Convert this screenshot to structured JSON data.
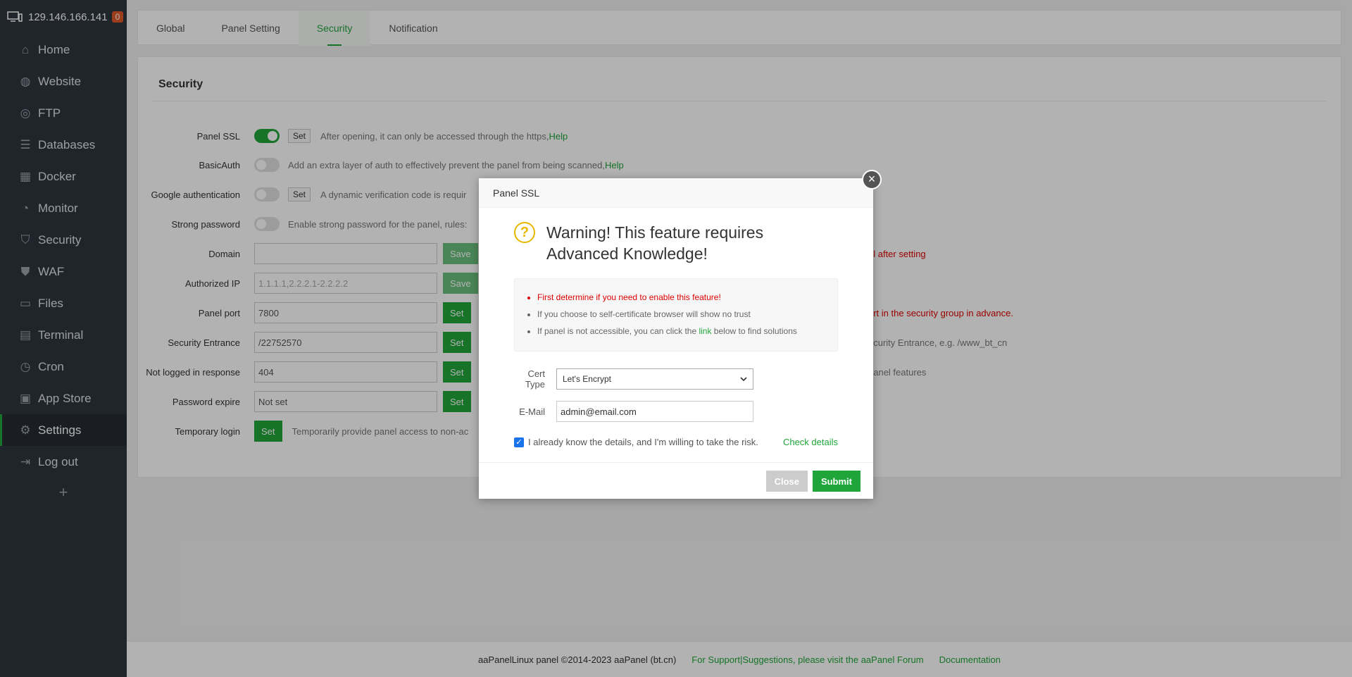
{
  "sidebar": {
    "host": "129.146.166.141",
    "badge": "0",
    "items": [
      {
        "label": "Home",
        "icon": "home-icon"
      },
      {
        "label": "Website",
        "icon": "globe-icon"
      },
      {
        "label": "FTP",
        "icon": "ftp-icon"
      },
      {
        "label": "Databases",
        "icon": "database-icon"
      },
      {
        "label": "Docker",
        "icon": "docker-icon"
      },
      {
        "label": "Monitor",
        "icon": "monitor-icon"
      },
      {
        "label": "Security",
        "icon": "shield-icon"
      },
      {
        "label": "WAF",
        "icon": "waf-icon"
      },
      {
        "label": "Files",
        "icon": "folder-icon"
      },
      {
        "label": "Terminal",
        "icon": "terminal-icon"
      },
      {
        "label": "Cron",
        "icon": "clock-icon"
      },
      {
        "label": "App Store",
        "icon": "apps-icon"
      },
      {
        "label": "Settings",
        "icon": "gear-icon",
        "active": true
      },
      {
        "label": "Log out",
        "icon": "logout-icon"
      }
    ],
    "plus": "+"
  },
  "tabs": [
    "Global",
    "Panel Setting",
    "Security",
    "Notification"
  ],
  "panel": {
    "title": "Security",
    "panel_ssl": {
      "label": "Panel SSL",
      "btn": "Set",
      "desc": "After opening, it can only be accessed through the https,",
      "help": "Help"
    },
    "basic_auth": {
      "label": "BasicAuth",
      "desc": "Add an extra layer of auth to effectively prevent the panel from being scanned,",
      "help": "Help"
    },
    "google_auth": {
      "label": "Google authentication",
      "btn": "Set",
      "desc": "A dynamic verification code is requir"
    },
    "strong_pw": {
      "label": "Strong password",
      "desc": "Enable strong password for the panel, rules:"
    },
    "domain": {
      "label": "Domain",
      "value": "",
      "btn": "Save",
      "right": "el after setting"
    },
    "auth_ip": {
      "label": "Authorized IP",
      "placeholder": "1.1.1.1,2.2.2.1-2.2.2.2",
      "btn": "Save"
    },
    "panel_port": {
      "label": "Panel port",
      "value": "7800",
      "btn": "Set",
      "right": "ort in the security group in advance."
    },
    "entrance": {
      "label": "Security Entrance",
      "value": "/22752570",
      "btn": "Set",
      "right": "ecurity Entrance, e.g. /www_bt_cn"
    },
    "not_logged": {
      "label": "Not logged in response",
      "value": "404",
      "btn": "Set",
      "right": "panel features"
    },
    "pw_expire": {
      "label": "Password expire",
      "value": "Not set",
      "btn": "Set"
    },
    "temp_login": {
      "label": "Temporary login",
      "btn": "Set",
      "desc": "Temporarily provide panel access to non-ac"
    }
  },
  "footer": {
    "copyright": "aaPanelLinux panel ©2014-2023 aaPanel (bt.cn)",
    "support": "For Support|Suggestions, please visit the aaPanel Forum",
    "docs": "Documentation"
  },
  "modal": {
    "title": "Panel SSL",
    "close_x": "×",
    "warn_q": "?",
    "warning": "Warning! This feature requires Advanced Knowledge!",
    "notes": {
      "n1": "First determine if you need to enable this feature!",
      "n2": "If you choose to self-certificate browser will show no trust",
      "n3_pre": "If panel is not accessible, you can click the ",
      "n3_link": "link",
      "n3_post": " below to find solutions"
    },
    "cert_type_label": "Cert Type",
    "cert_type_value": "Let's Encrypt",
    "email_label": "E-Mail",
    "email_value": "admin@email.com",
    "checkbox_mark": "✓",
    "agree": "I already know the details, and I'm willing to take the risk.",
    "check_details": "Check details",
    "close_btn": "Close",
    "submit_btn": "Submit"
  },
  "colors": {
    "accent": "#20a53a",
    "sidebar": "#2f3640",
    "warning": "#d00"
  }
}
